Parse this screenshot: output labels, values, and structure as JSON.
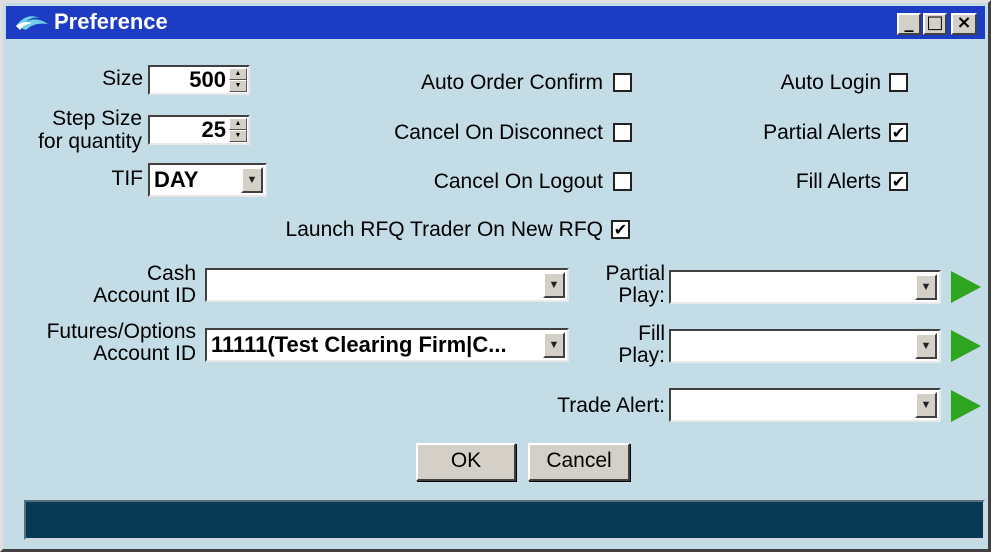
{
  "window": {
    "title": "Preference",
    "minimize": "_",
    "maximize": "□",
    "close": "×"
  },
  "left": {
    "size_label": "Size",
    "size_value": "500",
    "step_label_line1": "Step Size",
    "step_label_line2": "for quantity",
    "step_value": "25",
    "tif_label": "TIF",
    "tif_value": "DAY"
  },
  "middle": {
    "auto_order_confirm": {
      "label": "Auto Order Confirm",
      "checked": false
    },
    "cancel_on_disconnect": {
      "label": "Cancel On Disconnect",
      "checked": false
    },
    "cancel_on_logout": {
      "label": "Cancel On Logout",
      "checked": false
    },
    "launch_rfq": {
      "label": "Launch RFQ Trader On New RFQ",
      "checked": true
    }
  },
  "right": {
    "auto_login": {
      "label": "Auto Login",
      "checked": false
    },
    "partial_alerts": {
      "label": "Partial Alerts",
      "checked": true
    },
    "fill_alerts": {
      "label": "Fill Alerts",
      "checked": true
    }
  },
  "accounts": {
    "cash_label_line1": "Cash",
    "cash_label_line2": "Account ID",
    "cash_value": "",
    "futures_label_line1": "Futures/Options",
    "futures_label_line2": "Account ID",
    "futures_value": "11111(Test Clearing Firm|C..."
  },
  "sounds": {
    "partial_label_line1": "Partial",
    "partial_label_line2": "Play:",
    "partial_value": "",
    "fill_label_line1": "Fill",
    "fill_label_line2": "Play:",
    "fill_value": "",
    "trade_alert_label": "Trade Alert:",
    "trade_alert_value": ""
  },
  "buttons": {
    "ok": "OK",
    "cancel": "Cancel"
  },
  "icons": {
    "check_glyph": "✔",
    "down_arrow": "▼",
    "up_arrow": "▲",
    "play_color": "#2ea51f"
  },
  "status": {
    "text": "",
    "color": "#083a54"
  }
}
